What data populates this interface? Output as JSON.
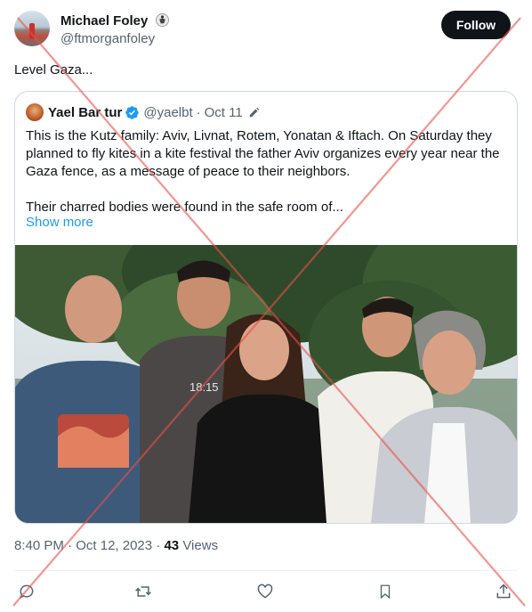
{
  "author": {
    "name": "Michael Foley",
    "handle": "@ftmorganfoley",
    "follow_label": "Follow"
  },
  "tweet": {
    "text": "Level Gaza...",
    "time": "8:40 PM",
    "date": "Oct 12, 2023",
    "views_count": "43",
    "views_label": "Views"
  },
  "quote": {
    "name": "Yael Bar tur",
    "handle": "@yaelbt",
    "dot": "·",
    "date": "Oct 11",
    "paragraph1": "This is the Kutz family: Aviv, Livnat, Rotem, Yonatan & Iftach.  On Saturday they planned to fly kites in a kite festival the father Aviv organizes every year near the Gaza fence, as a message of peace to their neighbors.",
    "paragraph2": "Their charred bodies were found in the safe room of...",
    "show_more": "Show more",
    "photo_shirt_text": "18:15"
  },
  "colors": {
    "accent": "#1d9bf0",
    "overlay_cross": "#e8504a"
  },
  "icons": [
    "martial-arts-icon",
    "verified-icon",
    "edit-icon",
    "reply-icon",
    "retweet-icon",
    "like-icon",
    "bookmark-icon",
    "share-icon"
  ]
}
